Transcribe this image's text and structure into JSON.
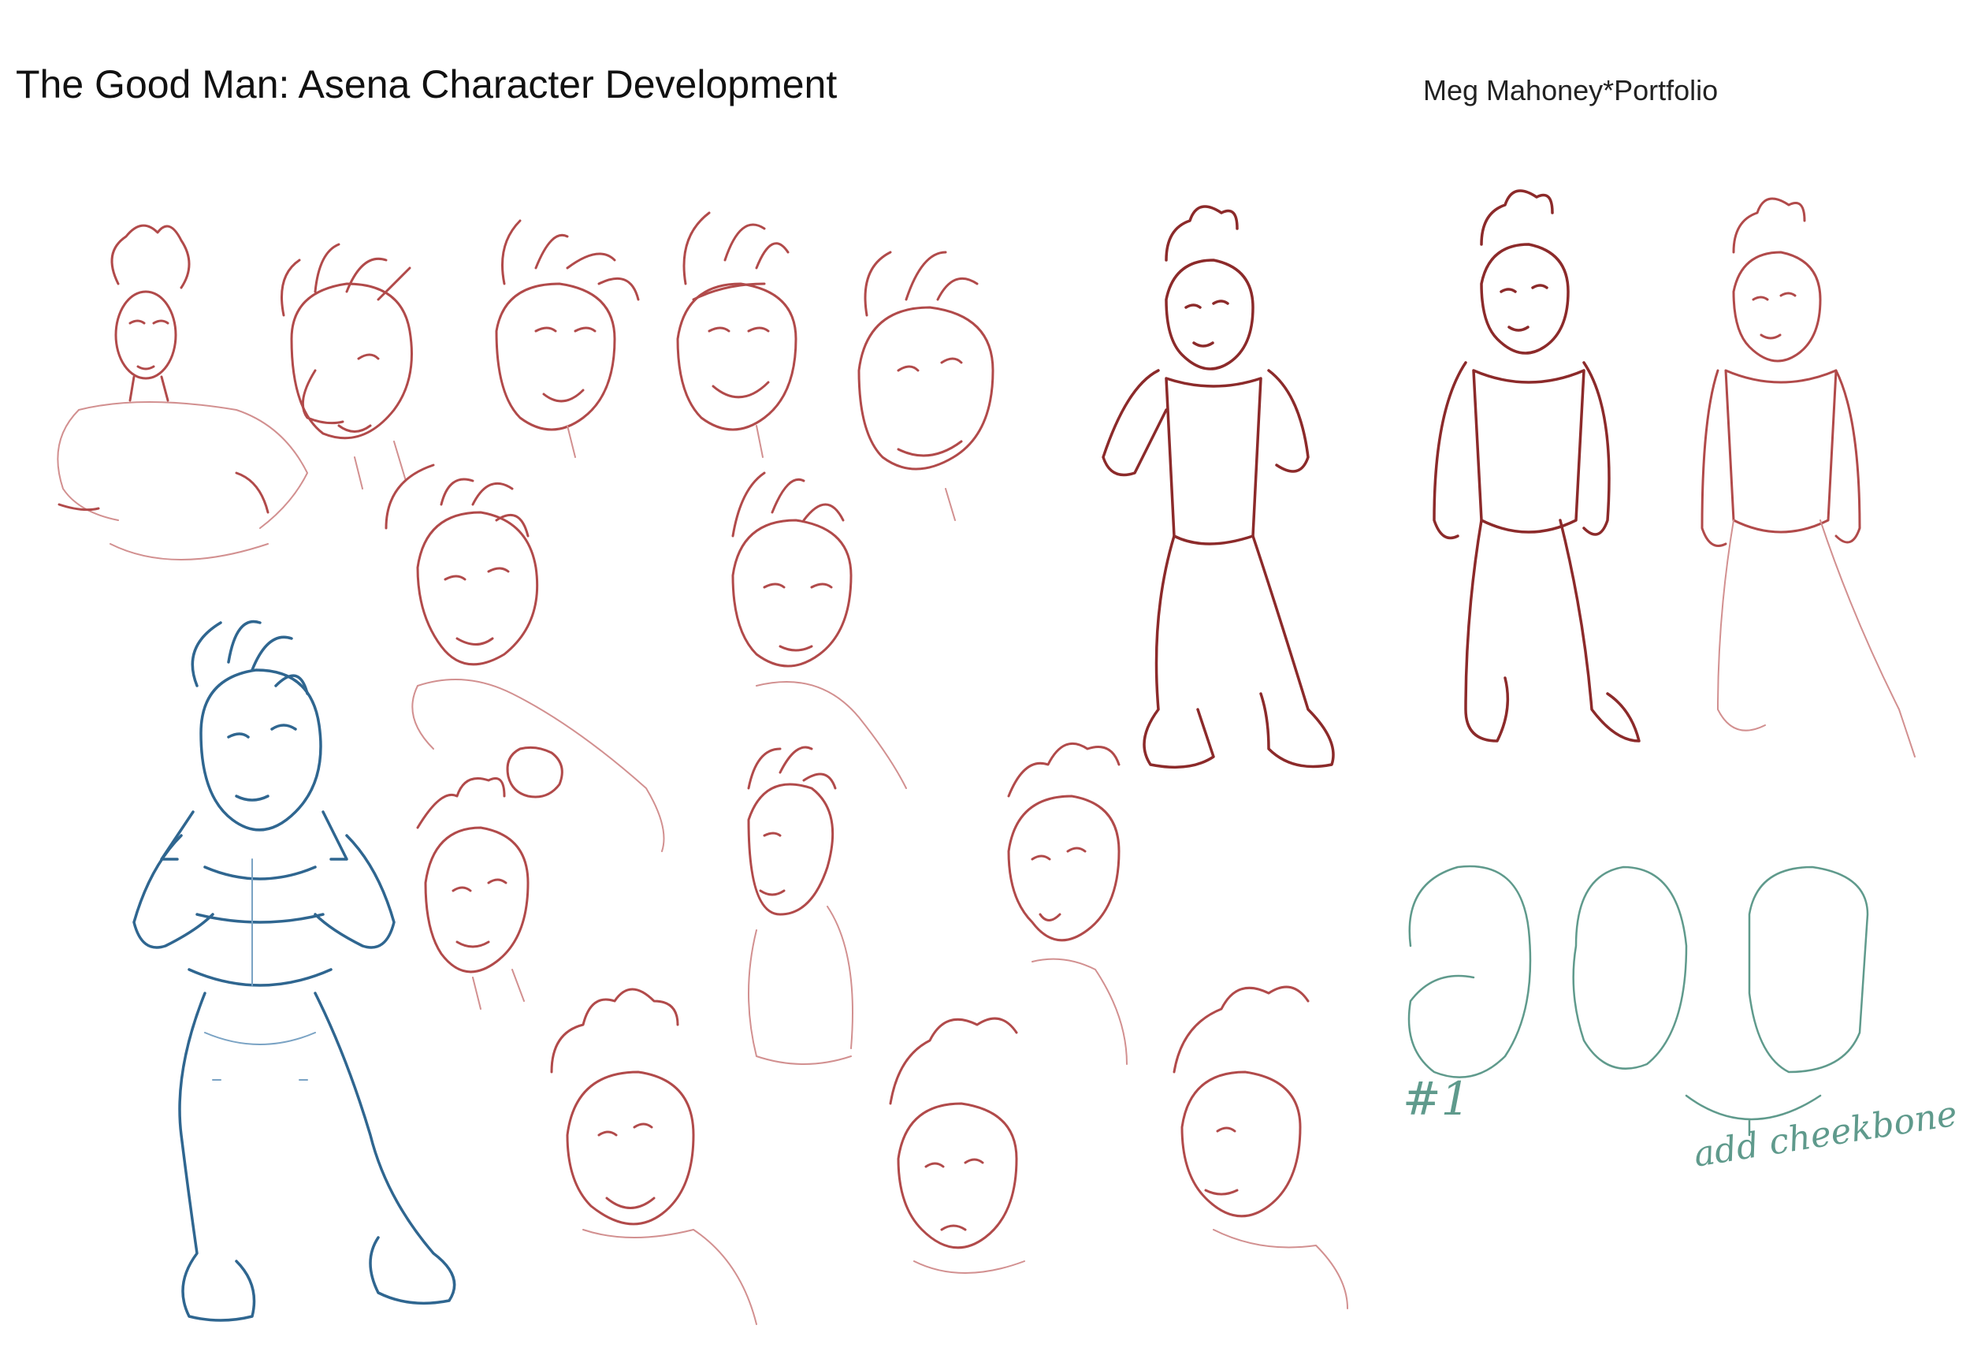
{
  "header": {
    "title": "The Good Man: Asena Character Development",
    "byline": "Meg Mahoney*Portfolio"
  },
  "notes": {
    "shape_number": "#1",
    "shape_note": "add cheekbone"
  },
  "colors": {
    "sketch_red": "#b14a4a",
    "sketch_dark_red": "#8c2a2a",
    "sketch_blue": "#2f6690",
    "sketch_teal": "#5f9a8c",
    "background": "#ffffff"
  }
}
